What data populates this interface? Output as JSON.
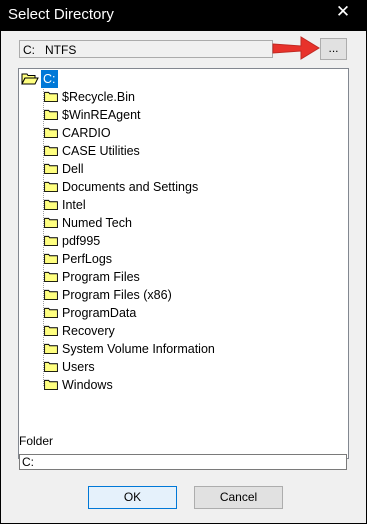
{
  "window": {
    "title": "Select Directory",
    "close_glyph": "✕"
  },
  "drive": {
    "value": "C:   NTFS",
    "browse_label": "..."
  },
  "tree": {
    "root": "C:",
    "folders": [
      "$Recycle.Bin",
      "$WinREAgent",
      "CARDIO",
      "CASE Utilities",
      "Dell",
      "Documents and Settings",
      "Intel",
      "Numed Tech",
      "pdf995",
      "PerfLogs",
      "Program Files",
      "Program Files (x86)",
      "ProgramData",
      "Recovery",
      "System Volume Information",
      "Users",
      "Windows"
    ]
  },
  "folder_field": {
    "label": "Folder",
    "value": "C:"
  },
  "buttons": {
    "ok": "OK",
    "cancel": "Cancel"
  },
  "icons": {
    "root": "open-folder-icon",
    "folder": "folder-icon",
    "annotation": "red-arrow-icon",
    "close": "close-icon"
  },
  "colors": {
    "titlebar": "#000000",
    "selection": "#0078d7",
    "folder_fill": "#ffff80",
    "annotation_arrow": "#e8322b"
  }
}
